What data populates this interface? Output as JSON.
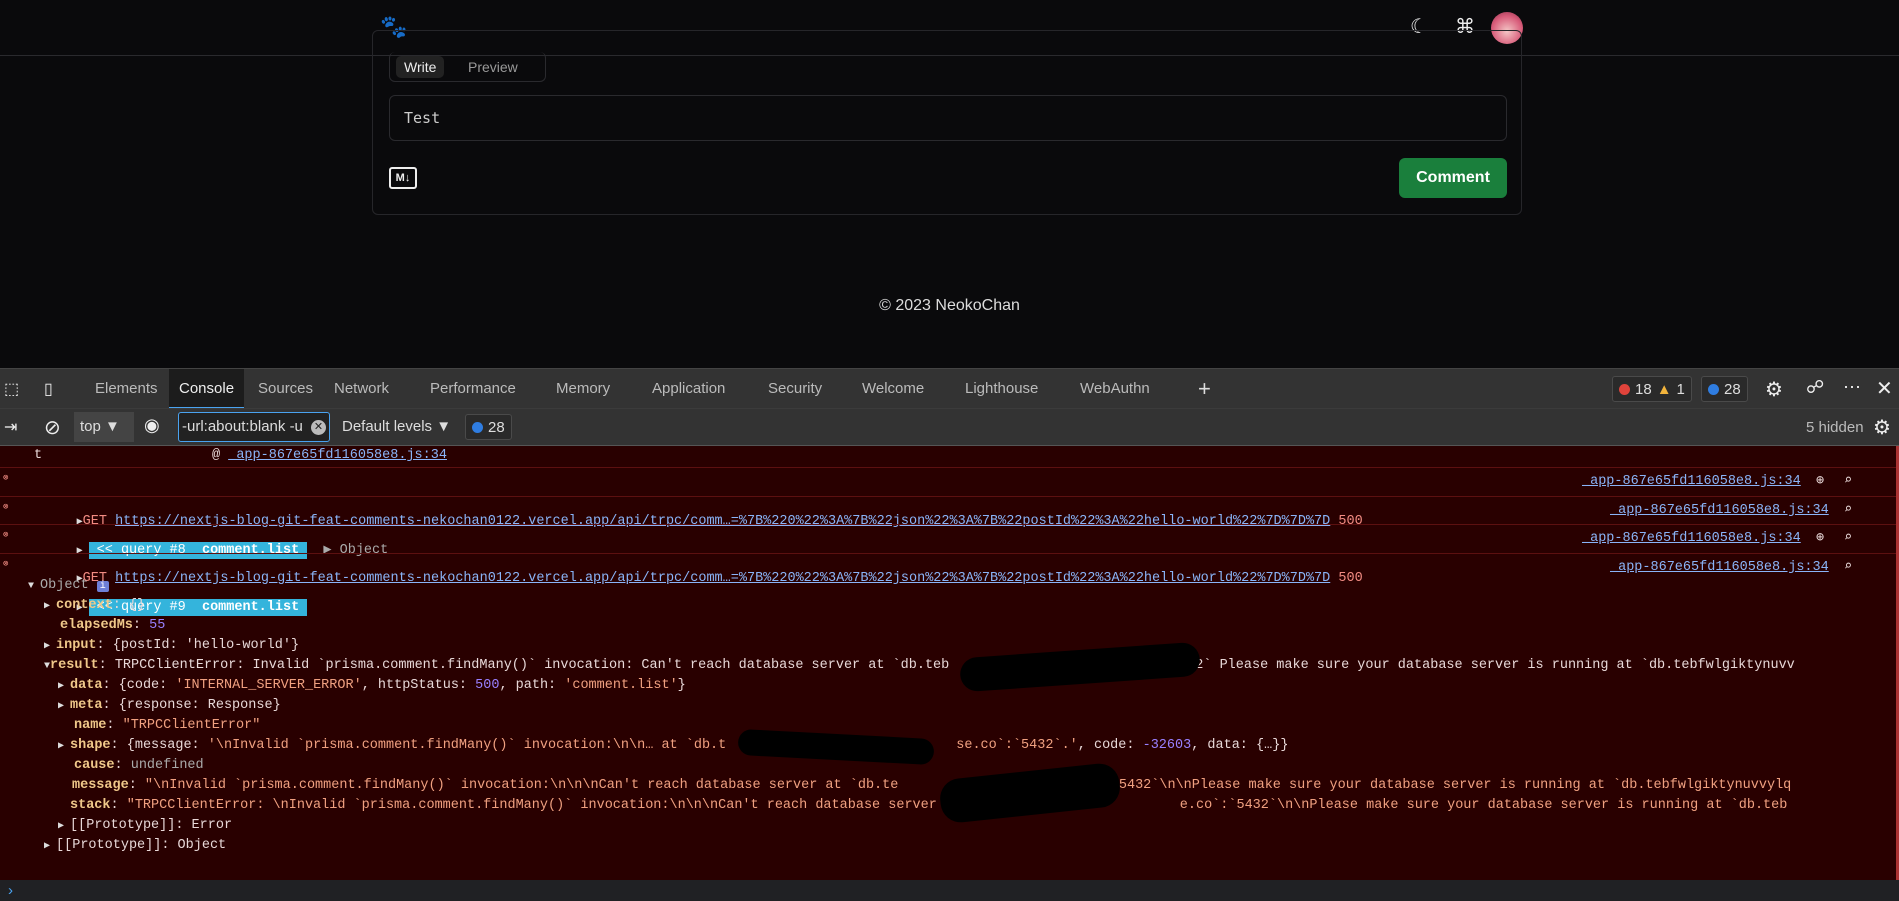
{
  "header": {
    "logo_icon": "paw-icon",
    "theme_icon": "moon-icon",
    "command_icon": "command-icon",
    "avatar": "avatar"
  },
  "editor": {
    "tabs": [
      "Write",
      "Preview"
    ],
    "textarea_value": "Test",
    "markdown_icon": "markdown-icon",
    "markdown_label": "M↓",
    "comment_button": "Comment"
  },
  "footer": {
    "copyright": "© 2023 NeokoChan"
  },
  "devtools": {
    "tabs": [
      "Elements",
      "Console",
      "Sources",
      "Network",
      "Performance",
      "Memory",
      "Application",
      "Security",
      "Welcome",
      "Lighthouse",
      "WebAuthn"
    ],
    "active_tab": "Console",
    "add_tab": "+",
    "counts": {
      "errors": "18",
      "warnings": "1",
      "info": "28"
    },
    "toolbar": {
      "context": "top",
      "filter_value": "-url:about:blank -u",
      "levels": "Default levels",
      "info_count": "28",
      "hidden": "5 hidden"
    },
    "console": {
      "l0_name": "t",
      "l0_at": "@",
      "l0_src": "_app-867e65fd116058e8.js:34",
      "get1_method": "GET",
      "get_url": "https://nextjs-blog-git-feat-comments-nekochan0122.vercel.app/api/trpc/comm…=%7B%220%22%3A%7B%22json%22%3A%7B%22postId%22%3A%22hello-world%22%7D%7D%7D",
      "get_status": "500",
      "src": "_app-867e65fd116058e8.js:34",
      "q8_tag": "<< query #8",
      "q8_proc": "comment.list",
      "q8_obj": "Object",
      "q9_tag": "<< query #9",
      "q9_proc": "comment.list",
      "object": "Object",
      "context": "context",
      "context_val": "{}",
      "elapsed": "elapsedMs",
      "elapsed_val": "55",
      "input": "input",
      "input_val": "{postId: 'hello-world'}",
      "result": "result",
      "result_a": "TRPCClientError: Invalid `prisma.comment.findMany()` invocation: Can't reach database server at `db.teb",
      "result_b": "e.co`:`5432` Please make sure your database server is running at `db.tebfwlgiktynuvv",
      "data": "data",
      "data_a": "{code: ",
      "data_code": "'INTERNAL_SERVER_ERROR'",
      "data_b": ", httpStatus: ",
      "data_status": "500",
      "data_c": ", path: ",
      "data_path": "'comment.list'",
      "data_d": "}",
      "meta": "meta",
      "meta_val": "{response: Response}",
      "name": "name",
      "name_val": "\"TRPCClientError\"",
      "shape": "shape",
      "shape_a": "{message: ",
      "shape_msg": "'\\nInvalid `prisma.comment.findMany()` invocation:\\n\\n… at `db.t",
      "shape_msg2": "se.co`:`5432`.'",
      "shape_b": ", code: ",
      "shape_code": "-32603",
      "shape_c": ", data: {…}}",
      "cause": "cause",
      "cause_val": "undefined",
      "message": "message",
      "message_a": "\"\\nInvalid `prisma.comment.findMany()` invocation:\\n\\n\\nCan't reach database server at `db.te",
      "message_b": "co`:`5432`\\n\\nPlease make sure your database server is running at `db.tebfwlgiktynuvvylq",
      "stack": "stack",
      "stack_a": "\"TRPCClientError: \\nInvalid `prisma.comment.findMany()` invocation:\\n\\n\\nCan't reach database server at `db.t",
      "stack_b": "e.co`:`5432`\\n\\nPlease make sure your database server is running at `db.teb",
      "proto_error": "[[Prototype]]: Error",
      "proto_object": "[[Prototype]]: Object"
    }
  },
  "colors": {
    "comment_button": "#1a7f3c",
    "console_error_bg": "#290000",
    "query_tag": "#34b4dc",
    "link": "#8ab4f8"
  }
}
